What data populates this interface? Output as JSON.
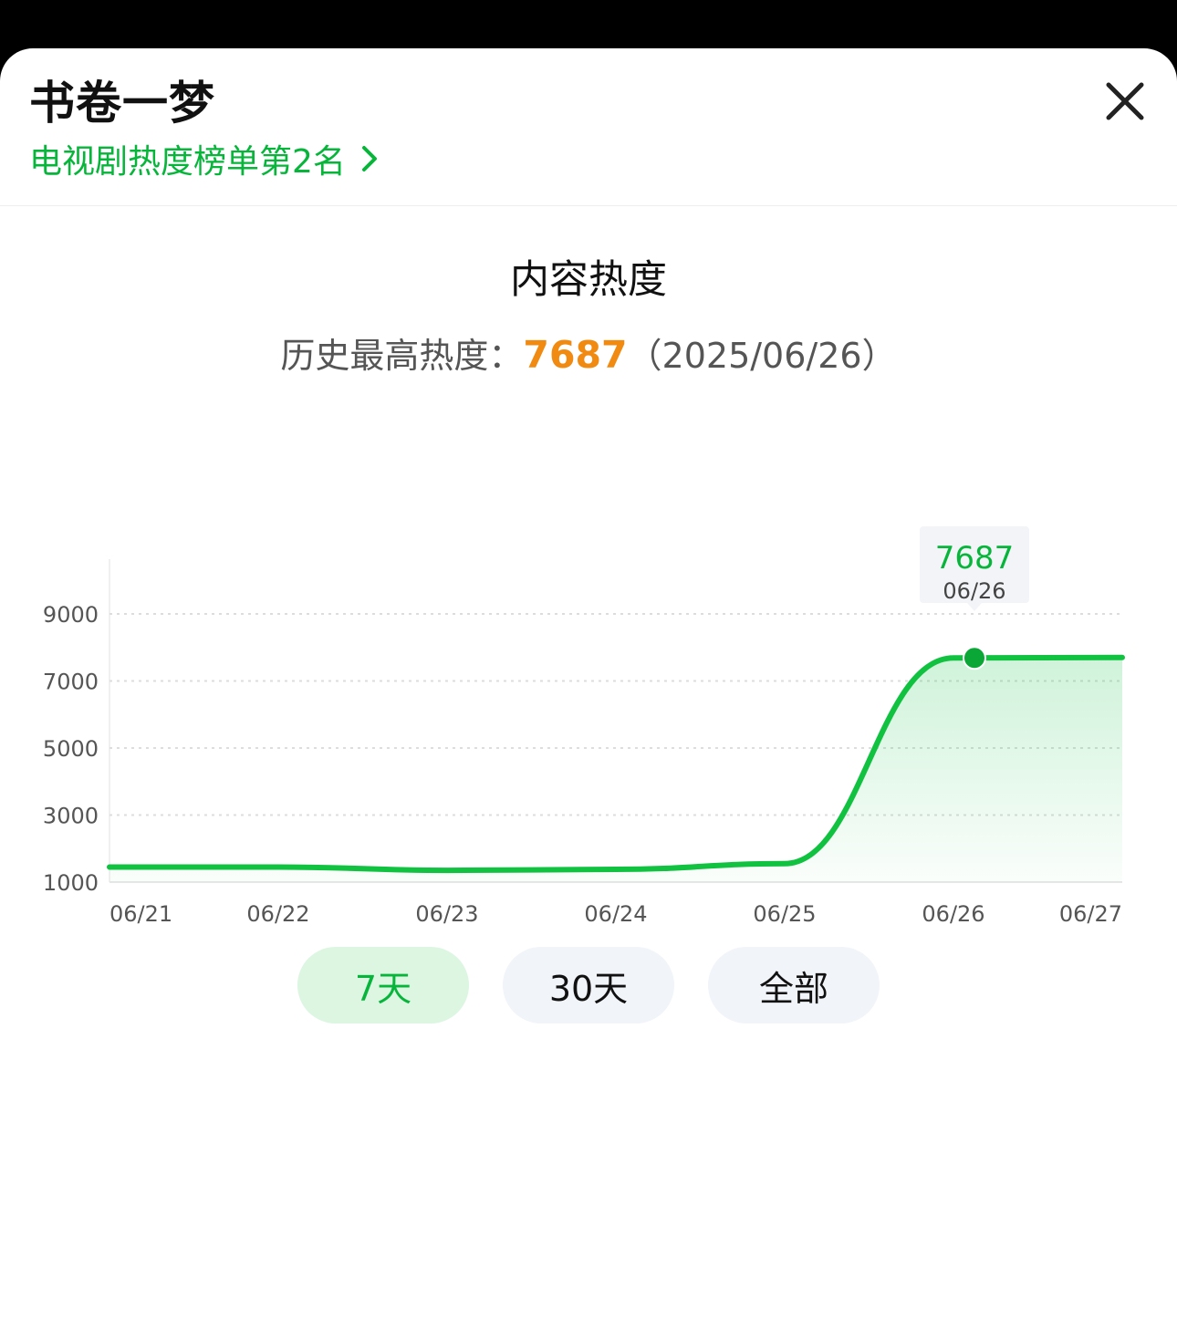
{
  "header": {
    "title": "书卷一梦",
    "rank_link": "电视剧热度榜单第2名"
  },
  "icons": {
    "close": "close-icon",
    "chevron": "chevron-right-icon"
  },
  "colors": {
    "accent": "#07b53b",
    "peak": "#f08a10"
  },
  "section": {
    "title": "内容热度",
    "record_label": "历史最高热度：",
    "record_value": "7687",
    "record_date": "（2025/06/26）"
  },
  "tooltip": {
    "value": "7687",
    "date": "06/26"
  },
  "tabs": [
    {
      "label": "7天",
      "active": true
    },
    {
      "label": "30天",
      "active": false
    },
    {
      "label": "全部",
      "active": false
    }
  ],
  "chart_data": {
    "type": "area",
    "x": [
      "06/21",
      "06/22",
      "06/23",
      "06/24",
      "06/25",
      "06/26",
      "06/27"
    ],
    "y_ticks": [
      1000,
      3000,
      5000,
      7000,
      9000
    ],
    "ylim": [
      1000,
      9000
    ],
    "series": [
      {
        "values": [
          1450,
          1450,
          1350,
          1380,
          1550,
          7687,
          7700
        ]
      }
    ],
    "highlight": {
      "x": "06/26",
      "value": 7687
    },
    "grid": true
  }
}
